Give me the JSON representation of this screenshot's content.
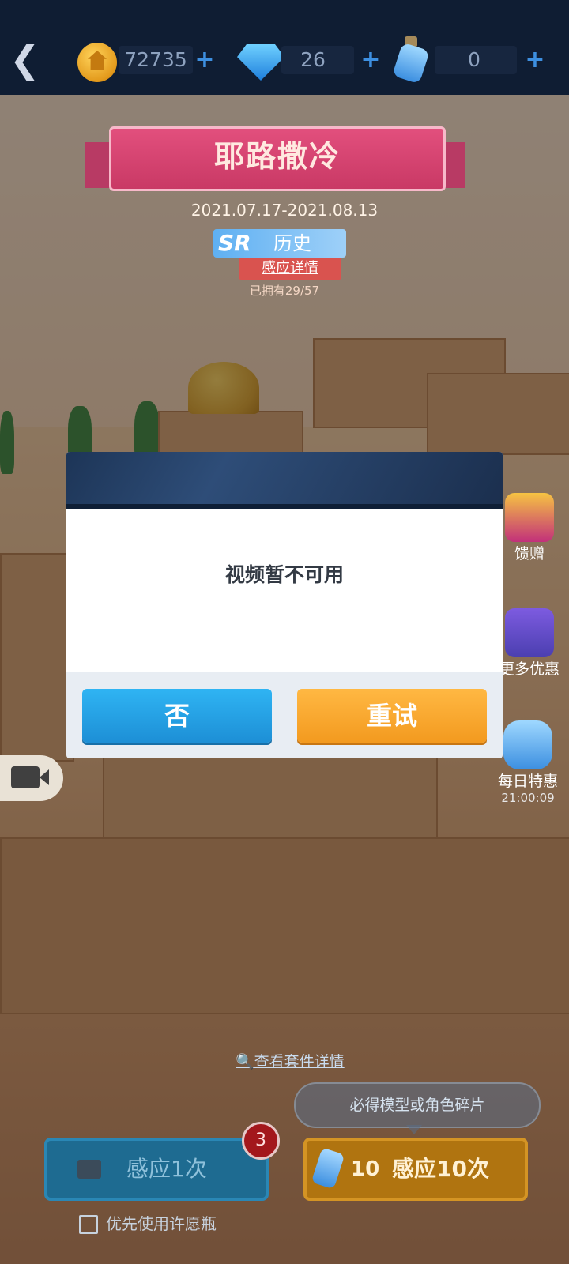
{
  "header": {
    "coins": "72735",
    "diamonds": "26",
    "bottles": "0",
    "plus": "+"
  },
  "event": {
    "title": "耶路撒冷",
    "date_range": "2021.07.17-2021.08.13",
    "rarity": "SR",
    "category": "历史",
    "detail_link": "感应详情",
    "collected": "已拥有29/57"
  },
  "side_menu": {
    "gift": "馈赠",
    "more_offers": "更多优惠",
    "daily_special": "每日特惠",
    "daily_timer": "21:00:09"
  },
  "dialog": {
    "message": "视频暂不可用",
    "no_label": "否",
    "retry_label": "重试"
  },
  "bottom": {
    "suit_details": "查看套件详情",
    "guarantee_tip": "必得模型或角色碎片",
    "sense_once": "感应1次",
    "sense_once_badge": "3",
    "sense_ten_cost": "10",
    "sense_ten": "感应10次",
    "prefer_bottle": "优先使用许愿瓶"
  },
  "colors": {
    "accent_blue": "#1d8fd6",
    "accent_orange": "#f39a1f",
    "banner_pink": "#c93965"
  }
}
